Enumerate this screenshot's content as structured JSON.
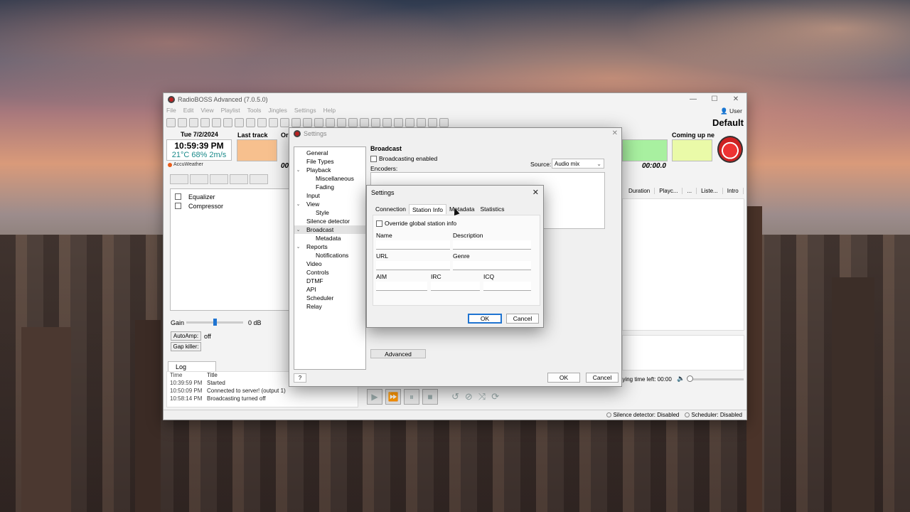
{
  "main": {
    "title": "RadioBOSS Advanced (7.0.5.0)",
    "menu": [
      "File",
      "Edit",
      "View",
      "Playlist",
      "Tools",
      "Jingles",
      "Settings",
      "Help"
    ],
    "user": "User",
    "profile": "Default",
    "date": "Tue 7/2/2024",
    "clock": "10:59:39 PM",
    "weather": "21°C 68% 2m/s",
    "weather_provider": "AccuWeather",
    "last_track_label": "Last track",
    "now_label_cut": "Or",
    "coming_up_label": "Coming up ne",
    "time_left_cut": "00:",
    "time_right": "00:00.0",
    "effects": [
      "Equalizer",
      "Compressor"
    ],
    "gain_label": "Gain",
    "gain_value": "0 dB",
    "autoamp_label": "AutoAmp:",
    "autoamp_value": "off",
    "gapkiller_label": "Gap killer:",
    "log_tab": "Log",
    "log_head": {
      "time": "Time",
      "title": "Title"
    },
    "log_rows": [
      {
        "time": "10:39:59 PM",
        "title": "Started"
      },
      {
        "time": "10:50:09 PM",
        "title": "Connected to server! (output 1)"
      },
      {
        "time": "10:58:14 PM",
        "title": "Broadcasting turned off"
      }
    ],
    "playlist_columns": [
      "Duration",
      "Playc...",
      "...",
      "Liste...",
      "Intro"
    ],
    "playing_time_left": "aying time left: 00:00",
    "status": {
      "silence": "Silence detector: Disabled",
      "scheduler": "Scheduler: Disabled"
    }
  },
  "settings": {
    "title": "Settings",
    "tree": [
      {
        "label": "General",
        "level": 0,
        "arrow": ""
      },
      {
        "label": "File Types",
        "level": 0,
        "arrow": ""
      },
      {
        "label": "Playback",
        "level": 0,
        "arrow": "v"
      },
      {
        "label": "Miscellaneous",
        "level": 1,
        "arrow": ""
      },
      {
        "label": "Fading",
        "level": 1,
        "arrow": ""
      },
      {
        "label": "Input",
        "level": 0,
        "arrow": ""
      },
      {
        "label": "View",
        "level": 0,
        "arrow": "v"
      },
      {
        "label": "Style",
        "level": 1,
        "arrow": ""
      },
      {
        "label": "Silence detector",
        "level": 0,
        "arrow": ""
      },
      {
        "label": "Broadcast",
        "level": 0,
        "arrow": "v",
        "selected": true
      },
      {
        "label": "Metadata",
        "level": 1,
        "arrow": ""
      },
      {
        "label": "Reports",
        "level": 0,
        "arrow": "v"
      },
      {
        "label": "Notifications",
        "level": 1,
        "arrow": ""
      },
      {
        "label": "Video",
        "level": 0,
        "arrow": ""
      },
      {
        "label": "Controls",
        "level": 0,
        "arrow": ""
      },
      {
        "label": "DTMF",
        "level": 0,
        "arrow": ""
      },
      {
        "label": "API",
        "level": 0,
        "arrow": ""
      },
      {
        "label": "Scheduler",
        "level": 0,
        "arrow": ""
      },
      {
        "label": "Relay",
        "level": 0,
        "arrow": ""
      }
    ],
    "help": "?",
    "broadcast_header": "Broadcast",
    "broadcasting_enabled": "Broadcasting enabled",
    "encoders_label": "Encoders:",
    "source_label": "Source:",
    "source_value": "Audio mix",
    "advanced": "Advanced",
    "ok": "OK",
    "cancel": "Cancel"
  },
  "encoder": {
    "title": "Settings",
    "tabs": [
      "Connection",
      "Station Info",
      "Metadata",
      "Statistics"
    ],
    "active_tab": "Station Info",
    "override": "Override global station info",
    "fields": {
      "name": "Name",
      "description": "Description",
      "url": "URL",
      "genre": "Genre",
      "aim": "AIM",
      "irc": "IRC",
      "icq": "ICQ"
    },
    "ok": "OK",
    "cancel": "Cancel"
  }
}
